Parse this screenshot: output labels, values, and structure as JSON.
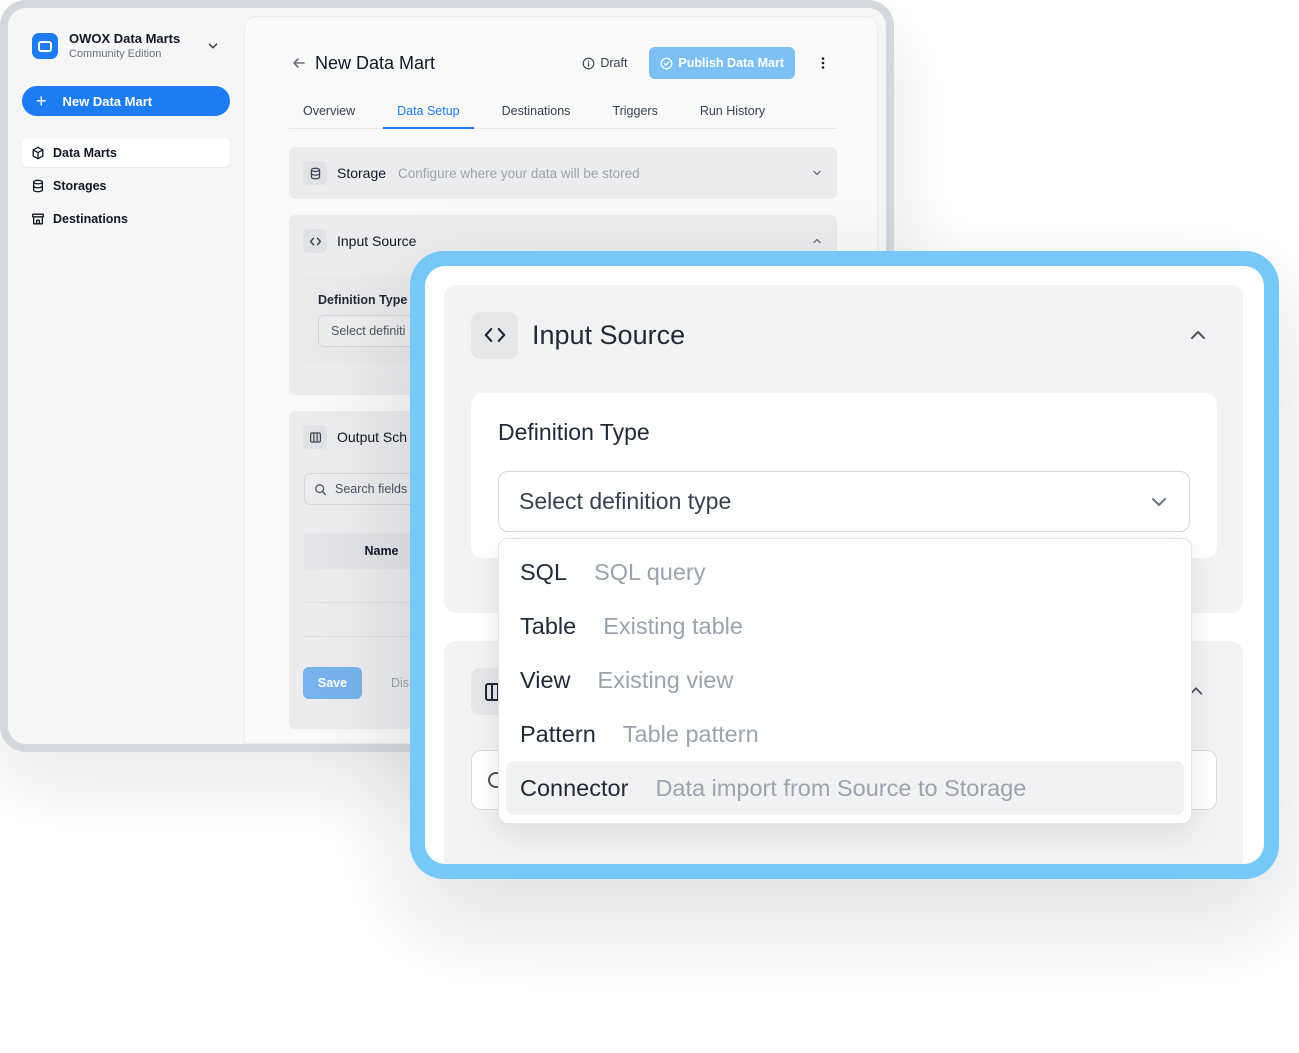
{
  "app": {
    "name": "OWOX Data Marts",
    "edition": "Community Edition"
  },
  "sidebar": {
    "new_button": "New Data Mart",
    "items": [
      {
        "label": "Data Marts",
        "icon": "cube-icon",
        "active": true
      },
      {
        "label": "Storages",
        "icon": "database-icon",
        "active": false
      },
      {
        "label": "Destinations",
        "icon": "store-icon",
        "active": false
      }
    ]
  },
  "header": {
    "title": "New Data Mart",
    "status": "Draft",
    "publish_button": "Publish Data Mart"
  },
  "tabs": [
    {
      "label": "Overview",
      "active": false
    },
    {
      "label": "Data Setup",
      "active": true
    },
    {
      "label": "Destinations",
      "active": false
    },
    {
      "label": "Triggers",
      "active": false
    },
    {
      "label": "Run History",
      "active": false
    }
  ],
  "storage_section": {
    "title": "Storage",
    "description": "Configure where your data will be stored"
  },
  "input_source": {
    "title": "Input Source",
    "definition_label": "Definition Type",
    "select_placeholder": "Select definition type",
    "select_placeholder_truncated": "Select definiti",
    "options": [
      {
        "name": "SQL",
        "description": "SQL query"
      },
      {
        "name": "Table",
        "description": "Existing table"
      },
      {
        "name": "View",
        "description": "Existing view"
      },
      {
        "name": "Pattern",
        "description": "Table pattern"
      },
      {
        "name": "Connector",
        "description": "Data import from Source to Storage"
      }
    ],
    "highlighted_option": "Connector"
  },
  "output_schema": {
    "title_truncated": "Output Sch",
    "search_placeholder": "Search fields",
    "column_name": "Name",
    "save_button": "Save",
    "discard_truncated": "Dis"
  },
  "colors": {
    "accent": "#1d7cf2",
    "publish_disabled": "#7cc0f5",
    "zoom_border": "#76c8f8"
  }
}
